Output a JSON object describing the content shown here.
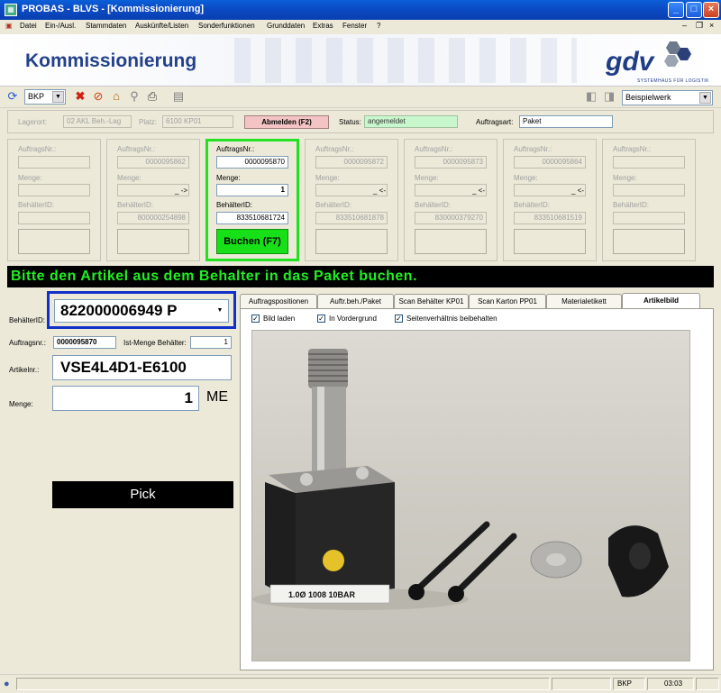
{
  "window": {
    "title": "PROBAS - BLVS - [Kommissionierung]"
  },
  "menu": [
    "Datei",
    "Ein-/Ausl.",
    "Stammdaten",
    "Auskünfte/Listen",
    "Sonderfunktionen",
    "Grunddaten",
    "Extras",
    "Fenster",
    "?"
  ],
  "banner": {
    "title": "Kommissionierung",
    "logo": "gdv",
    "logo_sub": "SYSTEMHAUS FÜR LOGISTIK"
  },
  "toolbar": {
    "mandant": "BKP",
    "werk": "Beispielwerk"
  },
  "header": {
    "lagerort_label": "Lagerort:",
    "lagerort_value": "02 AKL Beh.-Lag",
    "platz_label": "Platz:",
    "platz_value": "6100 KP01",
    "abmelden_label": "Abmelden (F2)",
    "status_label": "Status:",
    "status_value": "angemeldet",
    "auftragsart_label": "Auftragsart:",
    "auftragsart_value": "Paket"
  },
  "labels": {
    "auftrag": "AuftragsNr.:",
    "menge": "Menge:",
    "behaelter": "BehälterID:",
    "buchen": "Buchen (F7)"
  },
  "panels": [
    {
      "auftrag": "",
      "menge": "",
      "suffix": "",
      "behaelter": ""
    },
    {
      "auftrag": "0000095862",
      "menge": "",
      "suffix": "_ ->",
      "behaelter": "800000254898"
    },
    {
      "auftrag": "0000095870",
      "menge": "1",
      "suffix": "",
      "behaelter": "833510681724"
    },
    {
      "auftrag": "0000095872",
      "menge": "",
      "suffix": "_ <-",
      "behaelter": "833510681878"
    },
    {
      "auftrag": "0000095873",
      "menge": "",
      "suffix": "_ <-",
      "behaelter": "830000379270"
    },
    {
      "auftrag": "0000095864",
      "menge": "",
      "suffix": "_ <-",
      "behaelter": "833510681519"
    },
    {
      "auftrag": "",
      "menge": "",
      "suffix": "",
      "behaelter": ""
    }
  ],
  "message": "Bitte den Artikel aus dem Behalter in das Paket buchen.",
  "form": {
    "behaelter_label": "BehälterID:",
    "behaelter_value": "822000006949 P",
    "auftragsnr_label": "Auftragsnr.:",
    "auftragsnr_value": "0000095870",
    "istmenge_label": "Ist-Menge Behälter:",
    "istmenge_value": "1",
    "artikel_label": "Artikelnr.:",
    "artikel_value": "VSE4L4D1-E6100",
    "menge_label": "Menge:",
    "menge_value": "1",
    "menge_unit": "ME",
    "pick_label": "Pick"
  },
  "tabs": [
    "Auftragspositionen",
    "Auftr.beh./Paket",
    "Scan Behälter KP01",
    "Scan Karton PP01",
    "Materialetikett",
    "Artikelbild"
  ],
  "checkboxes": [
    "Bild laden",
    "In Vordergrund",
    "Seitenverhältnis beibehalten"
  ],
  "photo": {
    "label": "1.0Ø   1008   10BAR"
  },
  "status": {
    "mandant": "BKP",
    "time": "03:03"
  },
  "colors": {
    "active_green": "#22e022",
    "highlight_blue": "#1030c8",
    "title_blue": "#23418c"
  }
}
